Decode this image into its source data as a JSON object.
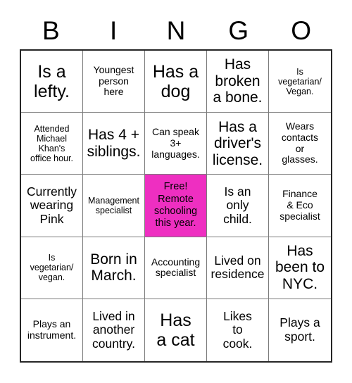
{
  "card": {
    "header_letters": [
      "B",
      "I",
      "N",
      "G",
      "O"
    ],
    "free_space_color": "#ee2fc1",
    "grid_line_color": "#7b7b7b",
    "border_color": "#262626",
    "text_color": "#000000",
    "background_color": "#ffffff",
    "rows": 5,
    "columns": 5,
    "cells": [
      {
        "text": "Is a\nlefty.",
        "size": "xl",
        "free": false
      },
      {
        "text": "Youngest\nperson\nhere",
        "size": "sm",
        "free": false
      },
      {
        "text": "Has a\ndog",
        "size": "xl",
        "free": false
      },
      {
        "text": "Has\nbroken\na bone.",
        "size": "lg",
        "free": false
      },
      {
        "text": "Is\nvegetarian/\nVegan.",
        "size": "xs",
        "free": false
      },
      {
        "text": "Attended\nMichael\nKhan's\noffice hour.",
        "size": "xs",
        "free": false
      },
      {
        "text": "Has 4 +\nsiblings.",
        "size": "lg",
        "free": false
      },
      {
        "text": "Can speak\n3+\nlanguages.",
        "size": "sm",
        "free": false
      },
      {
        "text": "Has a\ndriver's\nlicense.",
        "size": "lg",
        "free": false
      },
      {
        "text": "Wears\ncontacts\nor\nglasses.",
        "size": "sm",
        "free": false
      },
      {
        "text": "Currently\nwearing\nPink",
        "size": "md",
        "free": false
      },
      {
        "text": "Management\nspecialist",
        "size": "xs",
        "free": false
      },
      {
        "text": "Free!\nRemote\nschooling\nthis year.",
        "size": "sm",
        "free": true
      },
      {
        "text": "Is an\nonly\nchild.",
        "size": "md",
        "free": false
      },
      {
        "text": "Finance\n& Eco\nspecialist",
        "size": "sm",
        "free": false
      },
      {
        "text": "Is\nvegetarian/\nvegan.",
        "size": "xs",
        "free": false
      },
      {
        "text": "Born in\nMarch.",
        "size": "lg",
        "free": false
      },
      {
        "text": "Accounting\nspecialist",
        "size": "sm",
        "free": false
      },
      {
        "text": "Lived on\nresidence",
        "size": "md",
        "free": false
      },
      {
        "text": "Has\nbeen to\nNYC.",
        "size": "lg",
        "free": false
      },
      {
        "text": "Plays an\ninstrument.",
        "size": "sm",
        "free": false
      },
      {
        "text": "Lived in\nanother\ncountry.",
        "size": "md",
        "free": false
      },
      {
        "text": "Has\na cat",
        "size": "xl",
        "free": false
      },
      {
        "text": "Likes\nto\ncook.",
        "size": "md",
        "free": false
      },
      {
        "text": "Plays a\nsport.",
        "size": "md",
        "free": false
      }
    ]
  }
}
